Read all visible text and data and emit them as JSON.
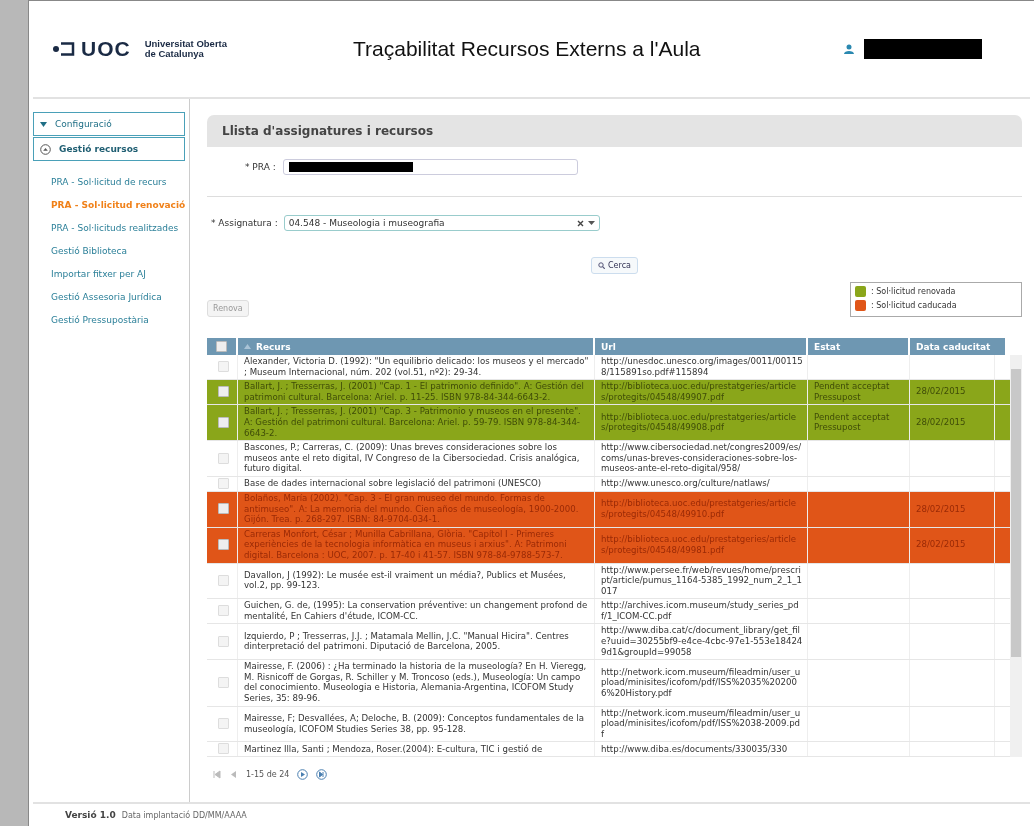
{
  "header": {
    "logo_text": "UOC",
    "institution": [
      "Universitat Oberta",
      "de Catalunya"
    ],
    "title": "Traçabilitat Recursos Externs a l'Aula"
  },
  "sidebar": {
    "items": [
      {
        "label": "Configuració",
        "kind": "section",
        "expanded": false
      },
      {
        "label": "Gestió recursos",
        "kind": "section",
        "expanded": true
      },
      {
        "label": "PRA - Sol·licitud de recurs",
        "kind": "link",
        "selected": false
      },
      {
        "label": "PRA - Sol·licitud renovació",
        "kind": "link",
        "selected": true
      },
      {
        "label": "PRA - Sol·licituds realitzades",
        "kind": "link",
        "selected": false
      },
      {
        "label": "Gestió Biblioteca",
        "kind": "link",
        "selected": false
      },
      {
        "label": "Importar fitxer per AJ",
        "kind": "link",
        "selected": false
      },
      {
        "label": "Gestió Assesoria Jurídica",
        "kind": "link",
        "selected": false
      },
      {
        "label": "Gestió Pressupostària",
        "kind": "link",
        "selected": false
      }
    ]
  },
  "panel": {
    "title": "Llista d'assignatures i recursos",
    "pra_label": "* PRA :",
    "subject_label": "* Assignatura :",
    "subject_value": "04.548 - Museologia i museografia",
    "search_button": "Cerca",
    "renew_button": {
      "label": "Renova",
      "disabled": true
    },
    "legend": [
      {
        "label": ": Sol·licitud renovada",
        "color": "#8aa61a"
      },
      {
        "label": ": Sol·licitud caducada",
        "color": "#e05518"
      }
    ]
  },
  "table": {
    "select_all_checked": false,
    "columns": [
      {
        "label": "Recurs",
        "sorted": true
      },
      {
        "label": "Url",
        "sorted": false
      },
      {
        "label": "Estat",
        "sorted": false
      },
      {
        "label": "Data caducitat",
        "sorted": false
      }
    ],
    "rows": [
      {
        "kind": "plain",
        "resource": "Alexander, Victoria D. (1992): \"Un equilibrio delicado: los museos y el mercado\" ; Museum Internacional, núm. 202 (vol.51, nº2): 29-34.",
        "url": "http://unesdoc.unesco.org/images/0011/001158/115891so.pdf#115894"
      },
      {
        "kind": "renewed",
        "resource": "Ballart, J. ; Tresserras, J. (2001) \"Cap. 1 - El patrimonio definido\". A: Gestión del patrimoni cultural. Barcelona: Ariel. p. 11-25. ISBN 978-84-344-6643-2.",
        "url": "http://biblioteca.uoc.edu/prestatgeries/articles/protegits/04548/49907.pdf",
        "status": "Pendent acceptat Pressupost",
        "expiry": "28/02/2015"
      },
      {
        "kind": "renewed",
        "resource": "Ballart, J. ; Tresserras, J. (2001) \"Cap. 3 - Patrimonio y museos en el presente\". A: Gestión del patrimoni cultural. Barcelona: Ariel. p. 59-79. ISBN 978-84-344-6643-2.",
        "url": "http://biblioteca.uoc.edu/prestatgeries/articles/protegits/04548/49908.pdf",
        "status": "Pendent acceptat Pressupost",
        "expiry": "28/02/2015"
      },
      {
        "kind": "plain",
        "resource": "Bascones, P.; Carreras, C. (2009): Unas breves consideraciones sobre los museos ante el reto digital, IV Congreso de la Cibersociedad. Crisis analógica, futuro digital.",
        "url": "http://www.cibersociedad.net/congres2009/es/coms/unas-breves-consideraciones-sobre-los-museos-ante-el-reto-digital/958/"
      },
      {
        "kind": "plain",
        "resource": "Base de dades internacional sobre legislació del patrimoni (UNESCO)",
        "url": "http://www.unesco.org/culture/natlaws/"
      },
      {
        "kind": "expired",
        "resource": "Bolaños, María (2002). \"Cap. 3 - El gran museo del mundo. Formas de antimuseo\". A: La memoria del mundo. Cien años de museología, 1900-2000. Gijón. Trea. p. 268-297. ISBN: 84-9704-034-1.",
        "url": "http://biblioteca.uoc.edu/prestatgeries/articles/protegits/04548/49910.pdf",
        "expiry": "28/02/2015"
      },
      {
        "kind": "expired",
        "resource": "Carreras Monfort, César ; Munilla Cabrillana, Glòria. \"Capítol I - Primeres experiències de la tecnologia informàtica en museus i arxius\". A: Patrimoni digital. Barcelona : UOC, 2007. p. 17-40 i 41-57. ISBN 978-84-9788-573-7.",
        "url": "http://biblioteca.uoc.edu/prestatgeries/articles/protegits/04548/49981.pdf",
        "expiry": "28/02/2015"
      },
      {
        "kind": "plain",
        "resource": "Davallon, J (1992): Le musée est-il vraiment un média?, Publics et Musées, vol.2, pp. 99-123.",
        "url": "http://www.persee.fr/web/revues/home/prescript/article/pumus_1164-5385_1992_num_2_1_1017"
      },
      {
        "kind": "plain",
        "resource": "Guichen, G. de, (1995): La conservation préventive: un changement profond de mentalité, En Cahiers d'étude, ICOM-CC.",
        "url": "http://archives.icom.museum/study_series_pdf/1_ICOM-CC.pdf"
      },
      {
        "kind": "plain",
        "resource": "Izquierdo, P ; Tresserras, J.J. ; Matamala Mellin, J.C. \"Manual Hicira\". Centres dinterpretació del patrimoni. Diputació de Barcelona, 2005.",
        "url": "http://www.diba.cat/c/document_library/get_file?uuid=30255bf9-e4ce-4cbc-97e1-553e184249d1&groupId=99058"
      },
      {
        "kind": "plain",
        "resource": "Mairesse, F. (2006) : ¿Ha terminado la historia de la museología? En H. Vieregg, M. Risnicoff de Gorgas, R. Schiller y M. Troncoso (eds.), Museología: Un campo del conocimiento. Museologia e Historia, Alemania-Argentina, ICOFOM Study Series, 35: 89-96.",
        "url": "http://network.icom.museum/fileadmin/user_upload/minisites/icofom/pdf/ISS%2035%202006%20History.pdf"
      },
      {
        "kind": "plain",
        "resource": "Mairesse, F; Desvallées, A; Deloche, B. (2009): Conceptos fundamentales de la museología, ICOFOM Studies Series 38, pp. 95-128.",
        "url": "http://network.icom.museum/fileadmin/user_upload/minisites/icofom/pdf/ISS%2038-2009.pdf"
      },
      {
        "kind": "plain",
        "resource": "Martinez Illa, Santi ; Mendoza, Roser.(2004): E-cultura, TIC i gestió de",
        "url": "http://www.diba.es/documents/330035/330"
      }
    ]
  },
  "pager": {
    "range": "1-15 de 24"
  },
  "footer": {
    "version": "Versió 1.0",
    "date": "Data implantació DD/MM/AAAA"
  }
}
